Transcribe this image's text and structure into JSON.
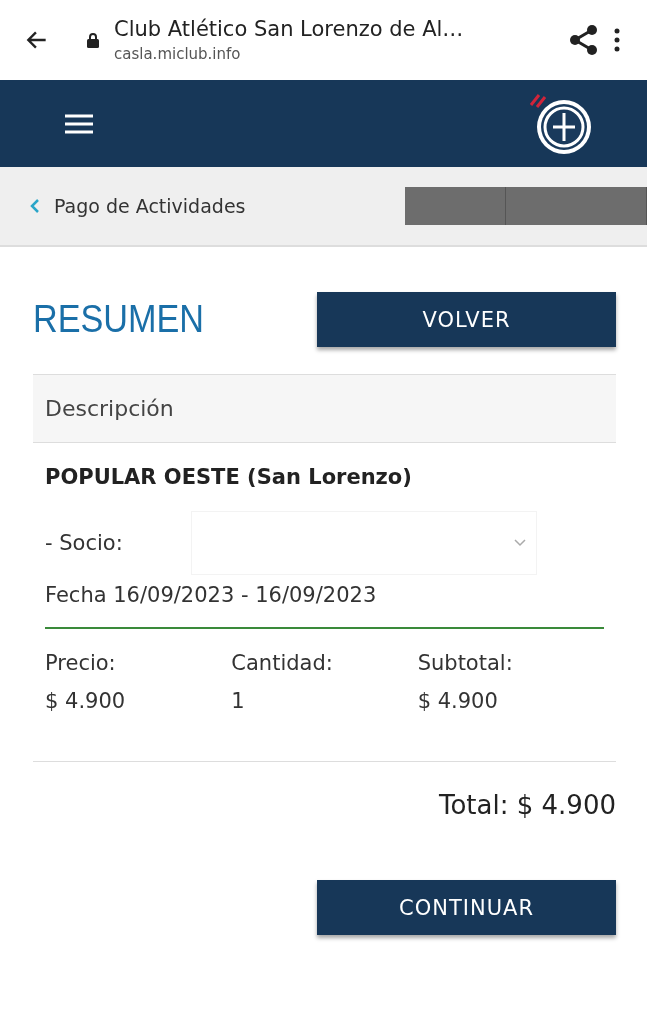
{
  "browser_bar": {
    "title": "Club Atlético San Lorenzo de Al…",
    "url": "casla.miclub.info"
  },
  "breadcrumb": {
    "label": "Pago de Actividades"
  },
  "summary": {
    "heading": "RESUMEN",
    "back_button": "VOLVER",
    "column_header": "Descripción",
    "item": {
      "name": "POPULAR OESTE (San Lorenzo)",
      "member_label": "- Socio:",
      "date": "Fecha 16/09/2023 - 16/09/2023",
      "columns": [
        {
          "label": "Precio:",
          "value": "$ 4.900"
        },
        {
          "label": "Cantidad:",
          "value": "1"
        },
        {
          "label": "Subtotal:",
          "value": "$ 4.900"
        }
      ]
    },
    "total": "Total: $ 4.900",
    "continue_button": "CONTINUAR"
  }
}
